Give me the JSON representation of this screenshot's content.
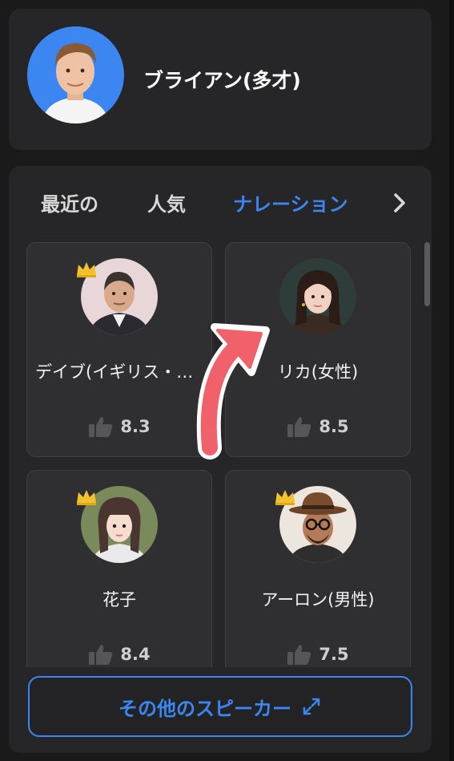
{
  "speaker": {
    "name": "ブライアン(多才)",
    "avatar_icon": "man-portrait-avatar"
  },
  "tabs": [
    {
      "label": "最近の",
      "active": false
    },
    {
      "label": "人気",
      "active": false
    },
    {
      "label": "ナレーション",
      "active": true
    }
  ],
  "voices": [
    {
      "name": "デイブ(イギリス・エセックス)",
      "rating": "8.3",
      "premium": true,
      "avatar_icon": "older-man-avatar"
    },
    {
      "name": "リカ(女性)",
      "rating": "8.5",
      "premium": false,
      "avatar_icon": "young-woman-avatar"
    },
    {
      "name": "花子",
      "rating": "8.4",
      "premium": true,
      "avatar_icon": "girl-avatar"
    },
    {
      "name": "アーロン(男性)",
      "rating": "7.5",
      "premium": true,
      "avatar_icon": "man-with-hat-avatar"
    }
  ],
  "more_button": {
    "label": "その他のスピーカー"
  },
  "colors": {
    "accent": "#3c86f2",
    "card": "#2f2f32",
    "panel": "#262628",
    "arrow": "#f0616b"
  }
}
